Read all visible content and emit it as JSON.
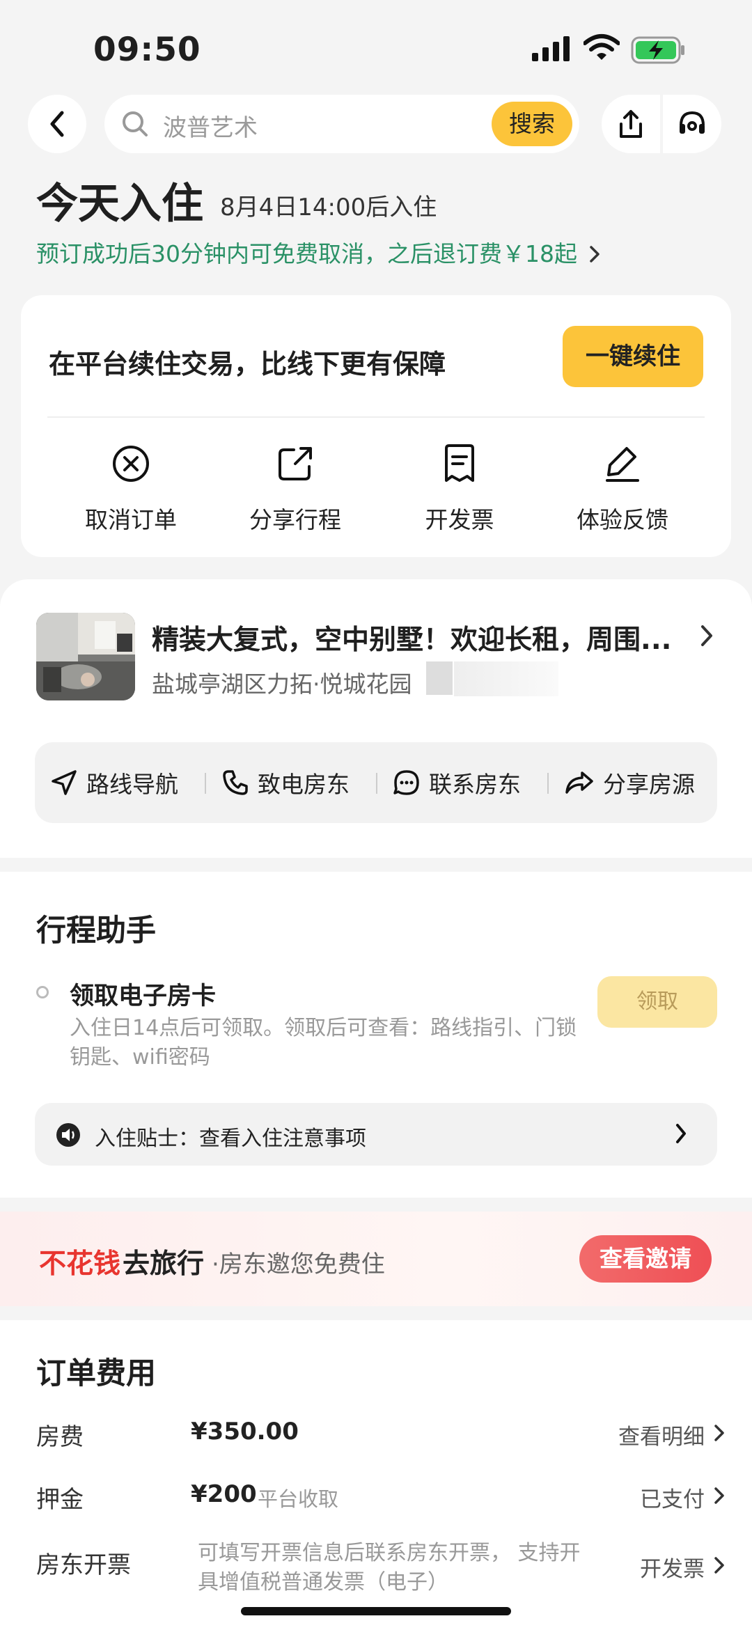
{
  "status_bar": {
    "time": "09:50"
  },
  "header": {
    "search_placeholder": "波普艺术",
    "search_button": "搜索"
  },
  "checkin": {
    "title": "今天入住",
    "time": "8月4日14:00后入住",
    "cancel_policy": "预订成功后30分钟内可免费取消，之后退订费￥18起"
  },
  "renew": {
    "text": "在平台续住交易，比线下更有保障",
    "button": "一键续住"
  },
  "actions": [
    {
      "label": "取消订单",
      "icon": "cancel-circle-icon"
    },
    {
      "label": "分享行程",
      "icon": "share-square-icon"
    },
    {
      "label": "开发票",
      "icon": "invoice-icon"
    },
    {
      "label": "体验反馈",
      "icon": "edit-pen-icon"
    }
  ],
  "property": {
    "title": "精装大复式，空中别墅！欢迎长租，周围...",
    "address": "盐城亭湖区力拓·悦城花园"
  },
  "property_actions": [
    {
      "label": "路线导航",
      "icon": "navigation-arrow-icon"
    },
    {
      "label": "致电房东",
      "icon": "phone-icon"
    },
    {
      "label": "联系房东",
      "icon": "chat-bubble-icon"
    },
    {
      "label": "分享房源",
      "icon": "forward-arrow-icon"
    }
  ],
  "assistant": {
    "title": "行程助手",
    "task_title": "领取电子房卡",
    "task_desc": "入住日14点后可领取。领取后可查看：路线指引、门锁钥匙、wifi密码",
    "task_button": "领取",
    "tips": "入住贴士：查看入住注意事项"
  },
  "promo": {
    "red": "不花钱",
    "black": "去旅行",
    "sub": "·房东邀您免费住",
    "button": "查看邀请"
  },
  "fees": {
    "title": "订单费用",
    "rows": [
      {
        "label": "房费",
        "value": "¥350.00",
        "action": "查看明细"
      },
      {
        "label": "押金",
        "value": "¥200",
        "sub": "平台收取",
        "action": "已支付"
      },
      {
        "label": "房东开票",
        "desc": "可填写开票信息后联系房东开票， 支持开具增值税普通发票（电子）",
        "action": "开发票"
      }
    ]
  },
  "colors": {
    "accent": "#fcc43a",
    "green": "#2a9166",
    "promo_red": "#e8352f"
  }
}
